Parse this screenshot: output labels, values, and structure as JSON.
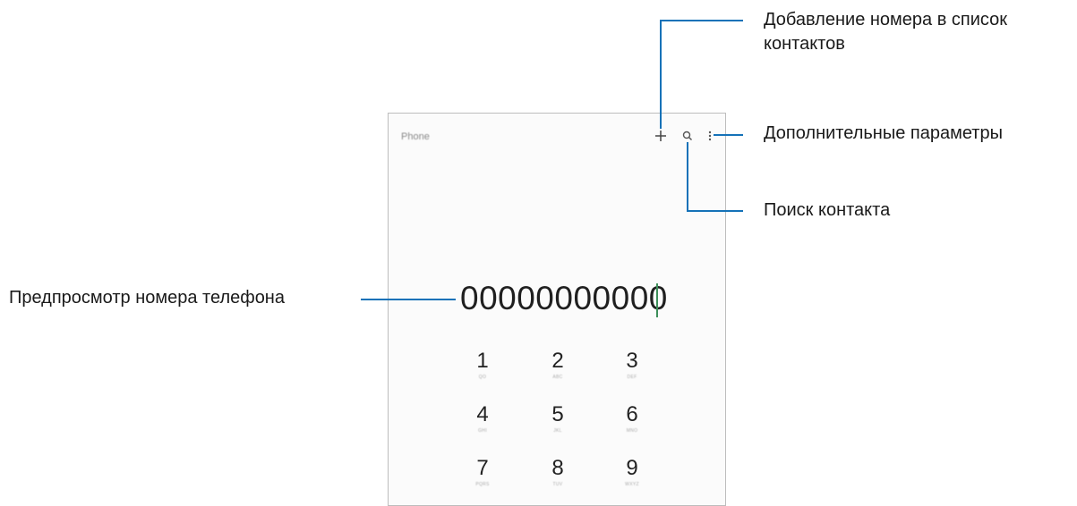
{
  "app": {
    "title": "Phone"
  },
  "toolbar": {
    "add_icon": "plus-icon",
    "search_icon": "search-icon",
    "more_icon": "more-vertical-icon"
  },
  "dialer": {
    "number": "00000000000",
    "keys": [
      {
        "digit": "1",
        "letters": "QO"
      },
      {
        "digit": "2",
        "letters": "ABC"
      },
      {
        "digit": "3",
        "letters": "DEF"
      },
      {
        "digit": "4",
        "letters": "GHI"
      },
      {
        "digit": "5",
        "letters": "JKL"
      },
      {
        "digit": "6",
        "letters": "MNO"
      },
      {
        "digit": "7",
        "letters": "PQRS"
      },
      {
        "digit": "8",
        "letters": "TUV"
      },
      {
        "digit": "9",
        "letters": "WXYZ"
      }
    ]
  },
  "callouts": {
    "add_contact_line1": "Добавление номера в список",
    "add_contact_line2": "контактов",
    "more_options": "Дополнительные параметры",
    "search_contact": "Поиск контакта",
    "number_preview": "Предпросмотр номера телефона"
  },
  "colors": {
    "callout_line": "#1572b8",
    "cursor": "#3d8f5a"
  }
}
